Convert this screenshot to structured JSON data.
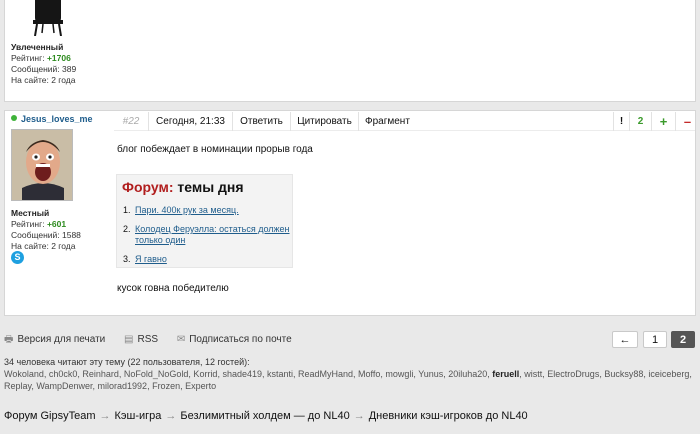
{
  "prev_post": {
    "rank": "Увлеченный",
    "rating_label": "Рейтинг:",
    "rating_value": "+1706",
    "messages": "Сообщений: 389",
    "on_site": "На сайте: 2 года"
  },
  "post": {
    "username": "Jesus_loves_me",
    "rank": "Местный",
    "rating_label": "Рейтинг:",
    "rating_value": "+601",
    "messages": "Сообщений: 1588",
    "on_site": "На сайте: 2 года",
    "number": "#22",
    "time": "Сегодня, 21:33",
    "reply": "Ответить",
    "quote": "Цитировать",
    "fragment": "Фрагмент",
    "report": "!",
    "votes": "2",
    "plus": "+",
    "minus": "–",
    "text_1": "блог побеждает в номинации прорыв года",
    "text_2": "кусок говна победителю",
    "widget": {
      "brand": "Форум:",
      "title": " темы дня",
      "items": [
        {
          "n": "1.",
          "text": "Пари. 400к рук за месяц."
        },
        {
          "n": "2.",
          "text": "Колодец Феруэлла: остаться должен только один"
        },
        {
          "n": "3.",
          "text": "Я гавно"
        }
      ]
    }
  },
  "bottom": {
    "print": "Версия для печати",
    "rss": "RSS",
    "subscribe": "Подписаться по почте"
  },
  "pager": {
    "prev": "←",
    "page1": "1",
    "page2": "2"
  },
  "readers": {
    "summary": "34 человека читают эту тему (22 пользователя, 12 гостей):",
    "users_before": "Wokoland,  ch0ck0,  Reinhard,  NoFold_NoGold,  Korrid,  shade419,  kstanti,  ReadMyHand,  Moffo,  mowgli,  Yunus,  20iluha20, ",
    "user_bold": "feruell",
    "users_after": ",  wistt,  ElectroDrugs,  Bucksy88,  iceiceberg,  Replay,  WampDenwer,  milorad1992,  Frozen,  Experto"
  },
  "breadcrumb": [
    "Форум GipsyTeam",
    "Кэш-игра",
    "Безлимитный холдем — до NL40",
    "Дневники кэш-игроков до NL40"
  ],
  "breadcrumb_sep": "→"
}
